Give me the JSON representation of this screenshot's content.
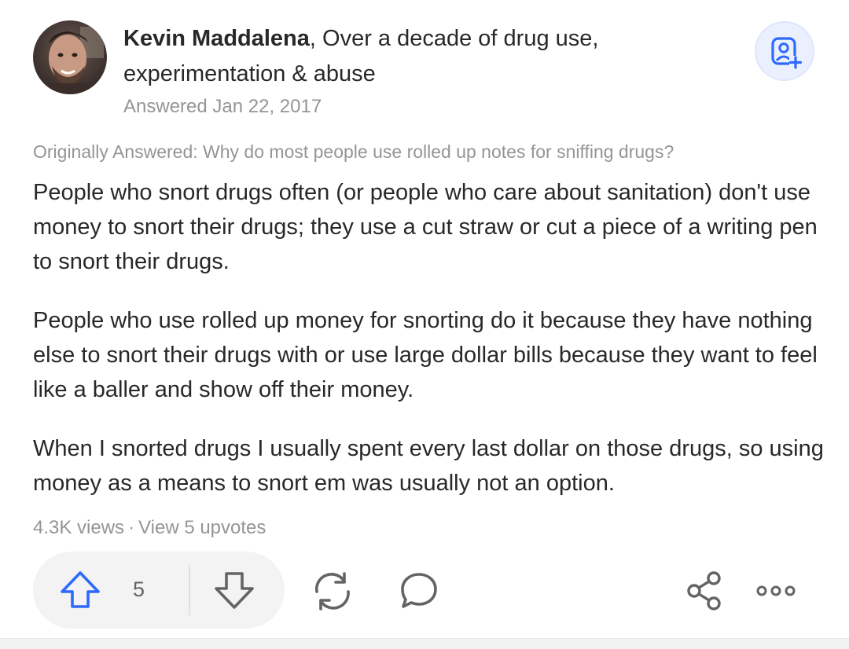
{
  "author": {
    "name": "Kevin Maddalena",
    "credential": ", Over a decade of drug use, experimentation & abuse",
    "answered": "Answered Jan 22, 2017"
  },
  "original_question": "Originally Answered: Why do most people use rolled up notes for sniffing drugs?",
  "answer": {
    "paragraphs": [
      "People who snort drugs often (or people who care about sanitation) don't use money to snort their drugs; they use a cut straw or cut a piece of a writing pen to snort their drugs.",
      "People who use rolled up money for snorting do it because they have nothing else to snort their drugs with or use large dollar bills because they want to feel like a baller and show off their money.",
      "When I snorted drugs I usually spent every last dollar on those drugs, so using money as a means to snort em was usually not an option."
    ]
  },
  "stats": {
    "views": "4.3K views",
    "separator": "·",
    "upvoters_link": "View 5 upvotes"
  },
  "actions": {
    "upvote_count": "5",
    "icons": [
      "upvote-arrow-icon",
      "downvote-arrow-icon",
      "share-repost-icon",
      "comment-bubble-icon",
      "share-nodes-icon",
      "more-options-icon",
      "follow-person-icon"
    ]
  },
  "colors": {
    "accent": "#2e69ff",
    "text": "#282829",
    "muted": "#939598",
    "pill": "#f3f3f4",
    "follow_bg": "#ebf0ff"
  }
}
